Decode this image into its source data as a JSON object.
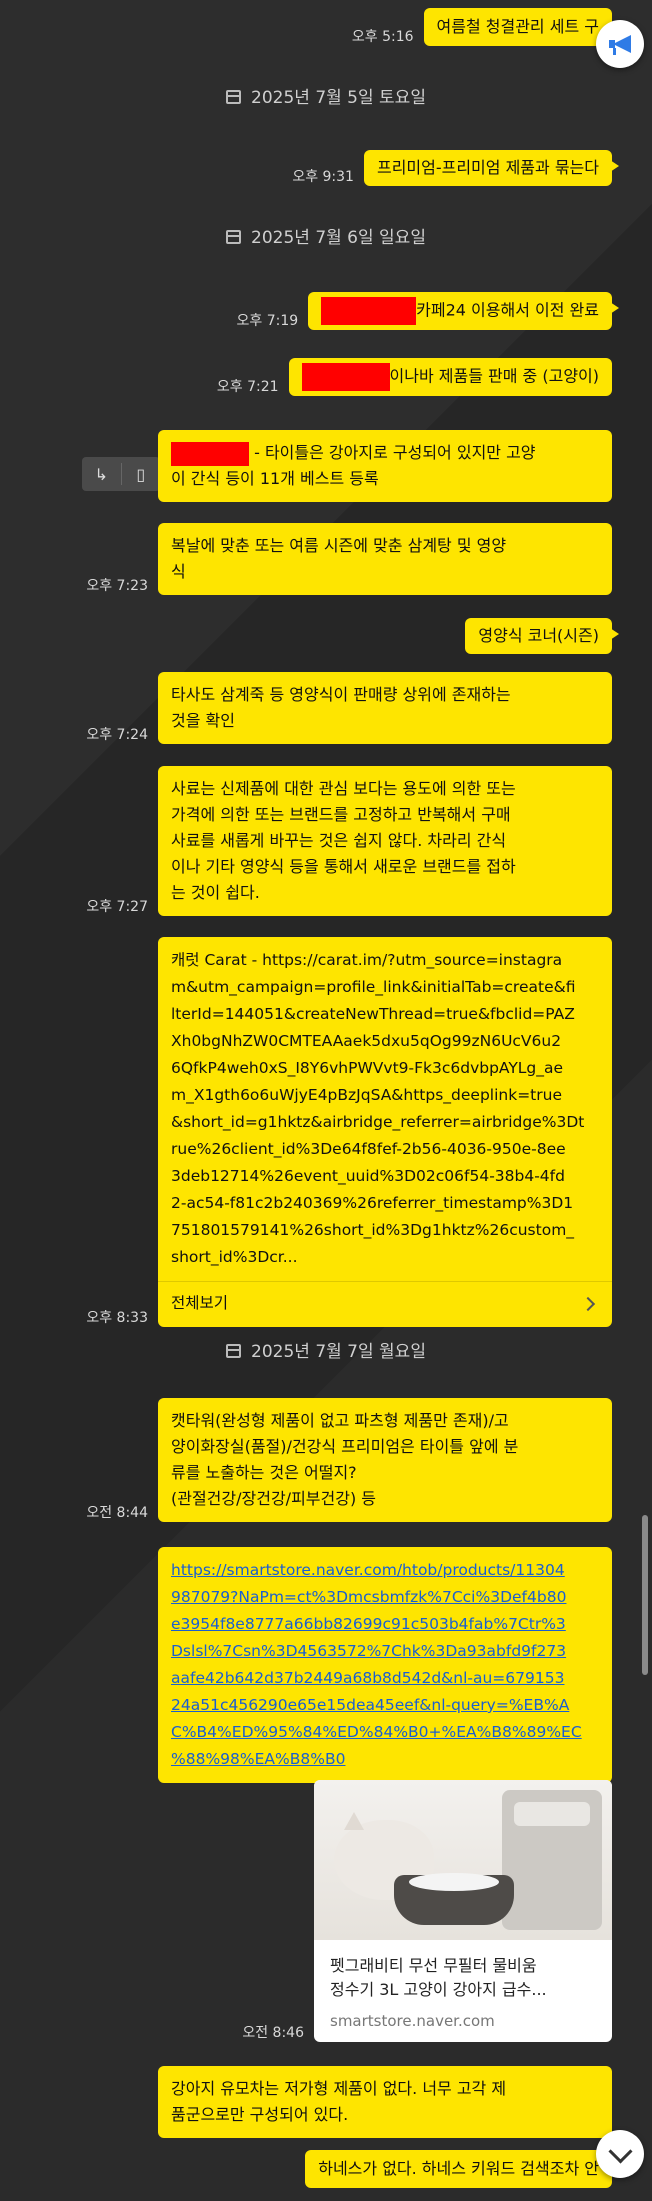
{
  "messages": {
    "m1": {
      "time": "오후 5:16",
      "text": "여름철 청결관리 세트 구"
    },
    "m2": {
      "time": "오후 9:31",
      "text": "프리미엄-프리미엄 제품과 묶는다"
    },
    "m3": {
      "time": "오후 7:19",
      "text": "카페24 이용해서 이전 완료"
    },
    "m4": {
      "time": "오후 7:21",
      "text": "이나바 제품들 판매 중 (고양이)"
    },
    "m5": {
      "time": "",
      "line1": " - 타이틀은 강아지로 구성되어 있지만 고양",
      "line2": "이 간식 등이 11개 베스트 등록"
    },
    "m6": {
      "time": "오후 7:23",
      "line1": "복날에 맞춘 또는 여름 시즌에 맞춘 삼계탕 및 영양",
      "line2": "식"
    },
    "m7": {
      "time": "",
      "text": "영양식 코너(시즌)"
    },
    "m8": {
      "time": "오후 7:24",
      "line1": "타사도 삼계죽 등 영양식이 판매량 상위에 존재하는",
      "line2": "것을 확인"
    },
    "m9": {
      "time": "오후 7:27",
      "line1": "사료는 신제품에 대한 관심 보다는 용도에 의한 또는",
      "line2": " 가격에 의한 또는 브랜드를 고정하고 반복해서 구매",
      "line3": " 사료를 새롭게 바꾸는 것은 쉽지 않다. 차라리 간식",
      "line4": "이나 기타 영양식 등을 통해서 새로운 브랜드를 접하",
      "line5": "는 것이 쉽다."
    },
    "m10": {
      "time": "오후 8:33",
      "lines": [
        "캐럿 Carat - https://carat.im/?utm_source=instagra",
        "m&utm_campaign=profile_link&initialTab=create&fi",
        "lterId=144051&createNewThread=true&fbclid=PAZ",
        "Xh0bgNhZW0CMTEAAaek5dxu5qOg99zN6UcV6u2",
        "6QfkP4weh0xS_I8Y6vhPWVvt9-Fk3c6dvbpAYLg_ae",
        "m_X1gth6o6uWjyE4pBzJqSA&https_deeplink=true",
        "&short_id=g1hktz&airbridge_referrer=airbridge%3Dt",
        "rue%26client_id%3De64f8fef-2b56-4036-950e-8ee",
        "3deb12714%26event_uuid%3D02c06f54-38b4-4fd",
        "2-ac54-f81c2b240369%26referrer_timestamp%3D1",
        "751801579141%26short_id%3Dg1hktz%26custom_",
        "short_id%3Dcr..."
      ],
      "more": "전체보기"
    },
    "m11": {
      "time": "오전 8:44",
      "lines": [
        "캣타워(완성형 제품이 없고 파츠형 제품만 존재)/고",
        "양이화장실(품절)/건강식 프리미엄은 타이틀 앞에 분",
        "류를 노출하는 것은 어떨지?",
        "(관절건강/장건강/피부건강) 등"
      ]
    },
    "m12": {
      "lines": [
        "https://smartstore.naver.com/htob/products/11304",
        "987079?NaPm=ct%3Dmcsbmfzk%7Cci%3Def4b80",
        "e3954f8e8777a66bb82699c91c503b4fab%7Ctr%3",
        "Dslsl%7Csn%3D4563572%7Chk%3Da93abfd9f273",
        "aafe42b642d37b2449a68b8d542d&nl-au=679153",
        "24a51c456290e65e15dea45eef&nl-query=%EB%A",
        "C%B4%ED%95%84%ED%84%B0+%EA%B8%89%EC",
        "%88%98%EA%B8%B0"
      ]
    },
    "m13": {
      "time": "오전 8:46",
      "title_line1": "펫그래비티 무선 무필터 물비움",
      "title_line2": "정수기 3L 고양이 강아지 급수...",
      "domain": "smartstore.naver.com"
    },
    "m14": {
      "line1": "강아지 유모차는 저가형 제품이 없다. 너무 고각 제",
      "line2": "품군으로만 구성되어 있다."
    },
    "m15": {
      "text": "하네스가 없다. 하네스 키워드 검색조차 안"
    }
  },
  "dates": {
    "d1": "2025년 7월 5일 토요일",
    "d2": "2025년 7월 6일 일요일",
    "d3": "2025년 7월 7일 월요일"
  },
  "icons": {
    "announce": "megaphone-icon",
    "scroll_down": "chevron-down-icon",
    "reply": "reply-icon",
    "bookmark": "bookmark-icon",
    "calendar": "calendar-icon"
  },
  "colors": {
    "bubble": "#fee500",
    "background": "#262626",
    "redaction": "#ff0000",
    "link": "#1a5fd0"
  }
}
